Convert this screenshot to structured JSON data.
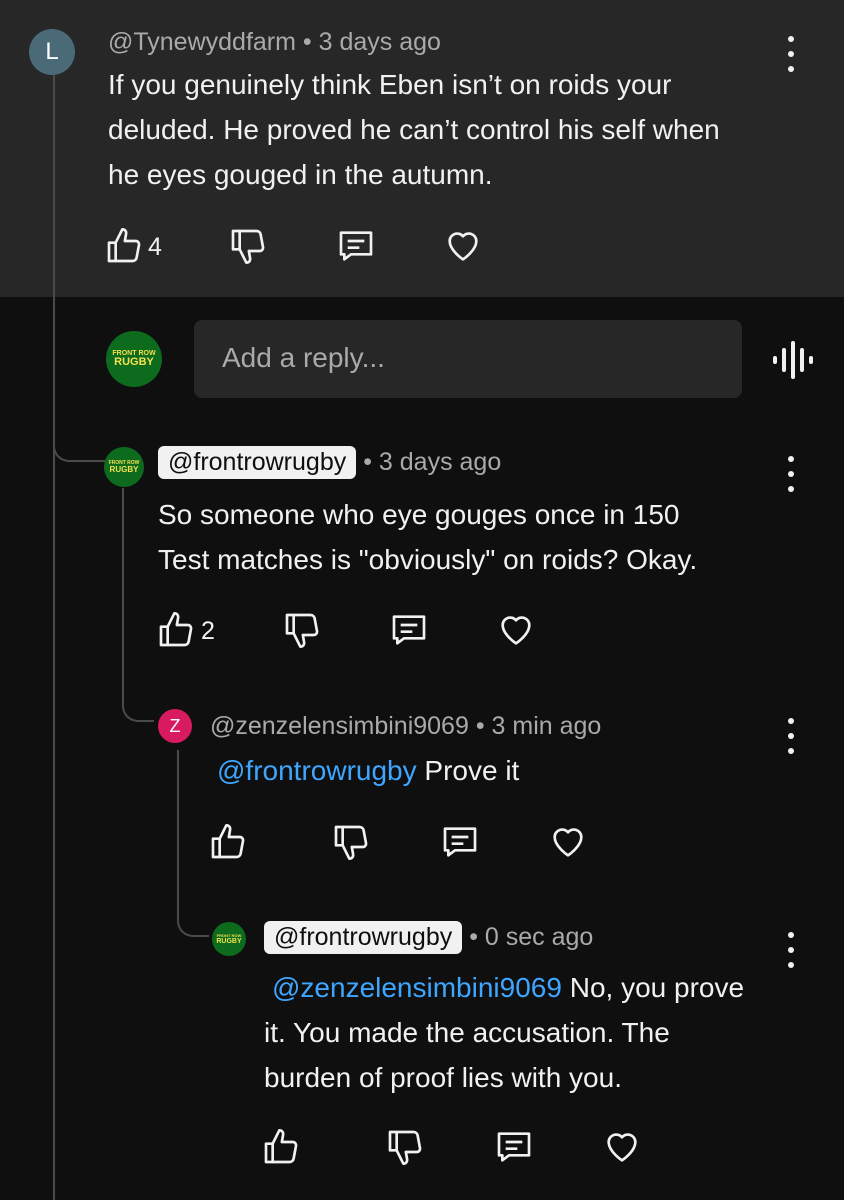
{
  "comments": [
    {
      "avatar_letter": "L",
      "handle": "@Tynewyddfarm",
      "time": "3 days ago",
      "lines": [
        "If you genuinely think Eben isn’t on roids your",
        "deluded. He proved he can’t control his self when",
        "he eyes gouged in the autumn."
      ],
      "likes": "4"
    },
    {
      "handle": "@frontrowrugby",
      "time": "3 days ago",
      "lines": [
        "So someone who eye gouges once in 150",
        "Test matches is \"obviously\" on roids? Okay."
      ],
      "likes": "2"
    },
    {
      "avatar_letter": "Z",
      "handle": "@zenzelensimbini9069",
      "time": "3 min ago",
      "mention": "@frontrowrugby",
      "text": " Prove it"
    },
    {
      "handle": "@frontrowrugby",
      "time": "0 sec ago",
      "mention": "@zenzelensimbini9069",
      "line1_rest": " No, you prove",
      "lines": [
        "it. You made the accusation. The",
        "burden of proof lies with you."
      ]
    }
  ],
  "reply": {
    "placeholder": "Add a reply..."
  },
  "logo": {
    "line1": "FRONT ROW",
    "line2": "RUGBY"
  },
  "separator": "•",
  "colors": {
    "background": "#0f0f0f",
    "card": "#272727",
    "mention": "#3ea6ff",
    "avatar_L": "#4b6a78",
    "avatar_Z": "#d81b60",
    "logo_green": "#0d6b1e",
    "logo_yellow": "#f4e04d"
  },
  "icons": [
    "like-icon",
    "dislike-icon",
    "reply-icon",
    "heart-icon",
    "more-vert-icon",
    "voice-search-icon"
  ]
}
